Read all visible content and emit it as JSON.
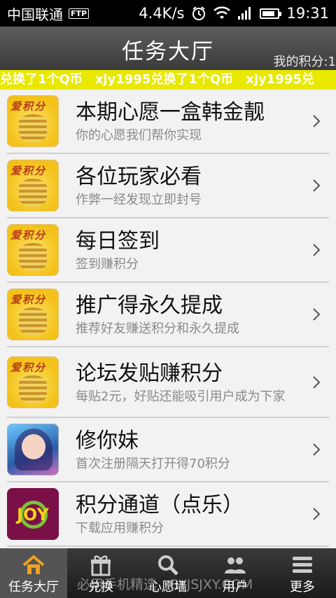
{
  "status": {
    "carrier": "中国联通",
    "ftp": "FTP",
    "speed": "4.4K/s",
    "time": "19:31",
    "battery_level": 0.85
  },
  "header": {
    "title": "任务大厅",
    "points_label": "我的积分:1"
  },
  "ticker": {
    "text": "兑换了1个Q币　xjy1995兑换了1个Q币　xjy1995兑"
  },
  "tasks": [
    {
      "name": "本期心愿一盒韩金靓",
      "desc": "你的心愿我们帮你实现",
      "icon": "coin-points-icon",
      "icon_label": "爱积分"
    },
    {
      "name": "各位玩家必看",
      "desc": "作弊一经发现立即封号",
      "icon": "coin-points-icon",
      "icon_label": "爱积分"
    },
    {
      "name": "每日签到",
      "desc": "签到赚积分",
      "icon": "coin-points-icon",
      "icon_label": "爱积分"
    },
    {
      "name": "推广得永久提成",
      "desc": "推荐好友赚送积分和永久提成",
      "icon": "coin-points-icon",
      "icon_label": "爱积分"
    },
    {
      "name": "论坛发贴赚积分",
      "desc": "每贴2元，好贴还能吸引用户成为下家",
      "icon": "coin-points-icon",
      "icon_label": "爱积分"
    },
    {
      "name": "修你妹",
      "desc": "首次注册隔天打开得70积分",
      "icon": "game-girl-icon"
    },
    {
      "name": "积分通道（点乐）",
      "desc": "下载应用赚积分",
      "icon": "jyy-logo-icon",
      "icon_label": "JOY"
    }
  ],
  "tabs": [
    {
      "label": "任务大厅",
      "icon": "home-icon",
      "active": true
    },
    {
      "label": "兑换",
      "icon": "gift-icon",
      "active": false
    },
    {
      "label": "心愿墙",
      "icon": "search-icon",
      "active": false
    },
    {
      "label": "用户",
      "icon": "users-icon",
      "active": false
    },
    {
      "label": "更多",
      "icon": "menu-icon",
      "active": false
    }
  ],
  "watermark": "必用手机精选　BYJSJXY.COM",
  "colors": {
    "ticker_bg": "#e8e800",
    "title_bg": "#4a4a4a",
    "tab_active": "#545454"
  }
}
